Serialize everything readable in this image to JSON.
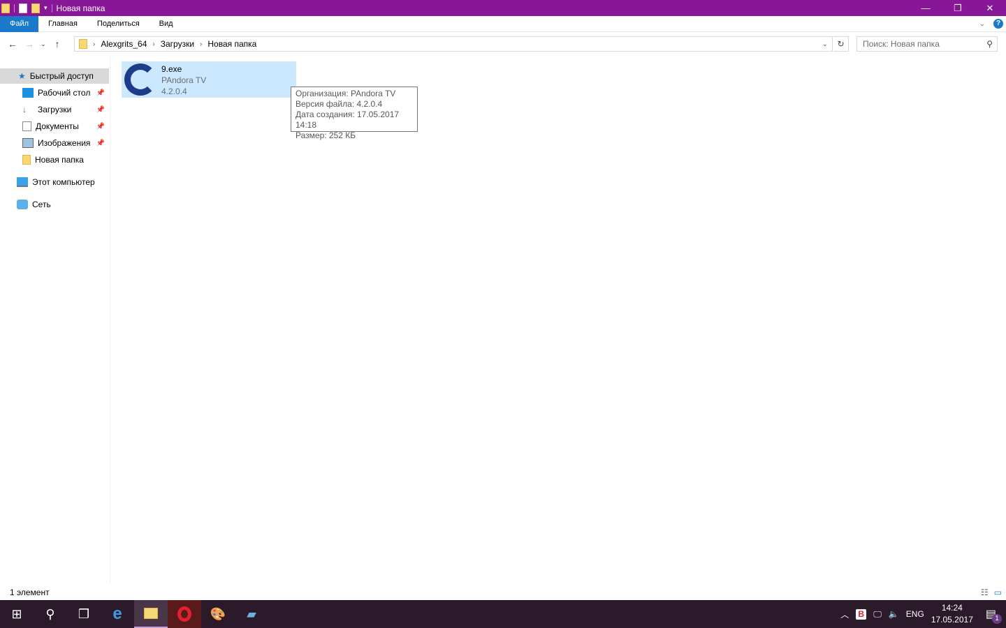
{
  "window": {
    "title": "Новая папка",
    "minimize": "—",
    "maximize": "❐",
    "close": "✕"
  },
  "ribbon": {
    "tabs": [
      "Файл",
      "Главная",
      "Поделиться",
      "Вид"
    ],
    "help": "?"
  },
  "nav": {
    "breadcrumbs": [
      "Alexgrits_64",
      "Загрузки",
      "Новая папка"
    ],
    "search_placeholder": "Поиск: Новая папка"
  },
  "sidebar": {
    "items": [
      {
        "label": "Быстрый доступ",
        "icon": "star-icon"
      },
      {
        "label": "Рабочий стол",
        "icon": "desktop-icon",
        "pinned": true
      },
      {
        "label": "Загрузки",
        "icon": "download-icon",
        "pinned": true
      },
      {
        "label": "Документы",
        "icon": "documents-icon",
        "pinned": true
      },
      {
        "label": "Изображения",
        "icon": "pictures-icon",
        "pinned": true
      },
      {
        "label": "Новая папка",
        "icon": "folder-icon"
      },
      {
        "label": "Этот компьютер",
        "icon": "computer-icon"
      },
      {
        "label": "Сеть",
        "icon": "network-icon"
      }
    ]
  },
  "file": {
    "name": "9.exe",
    "company": "PAndora TV",
    "version": "4.2.0.4"
  },
  "tooltip": {
    "lines": [
      "Организация: PAndora TV",
      "Версия файла: 4.2.0.4",
      "Дата создания: 17.05.2017 14:18",
      "Размер: 252 КБ"
    ]
  },
  "status": {
    "count": "1 элемент"
  },
  "taskbar": {
    "lang": "ENG",
    "time": "14:24",
    "date": "17.05.2017",
    "notifications": "1",
    "tray_badge": "B"
  }
}
